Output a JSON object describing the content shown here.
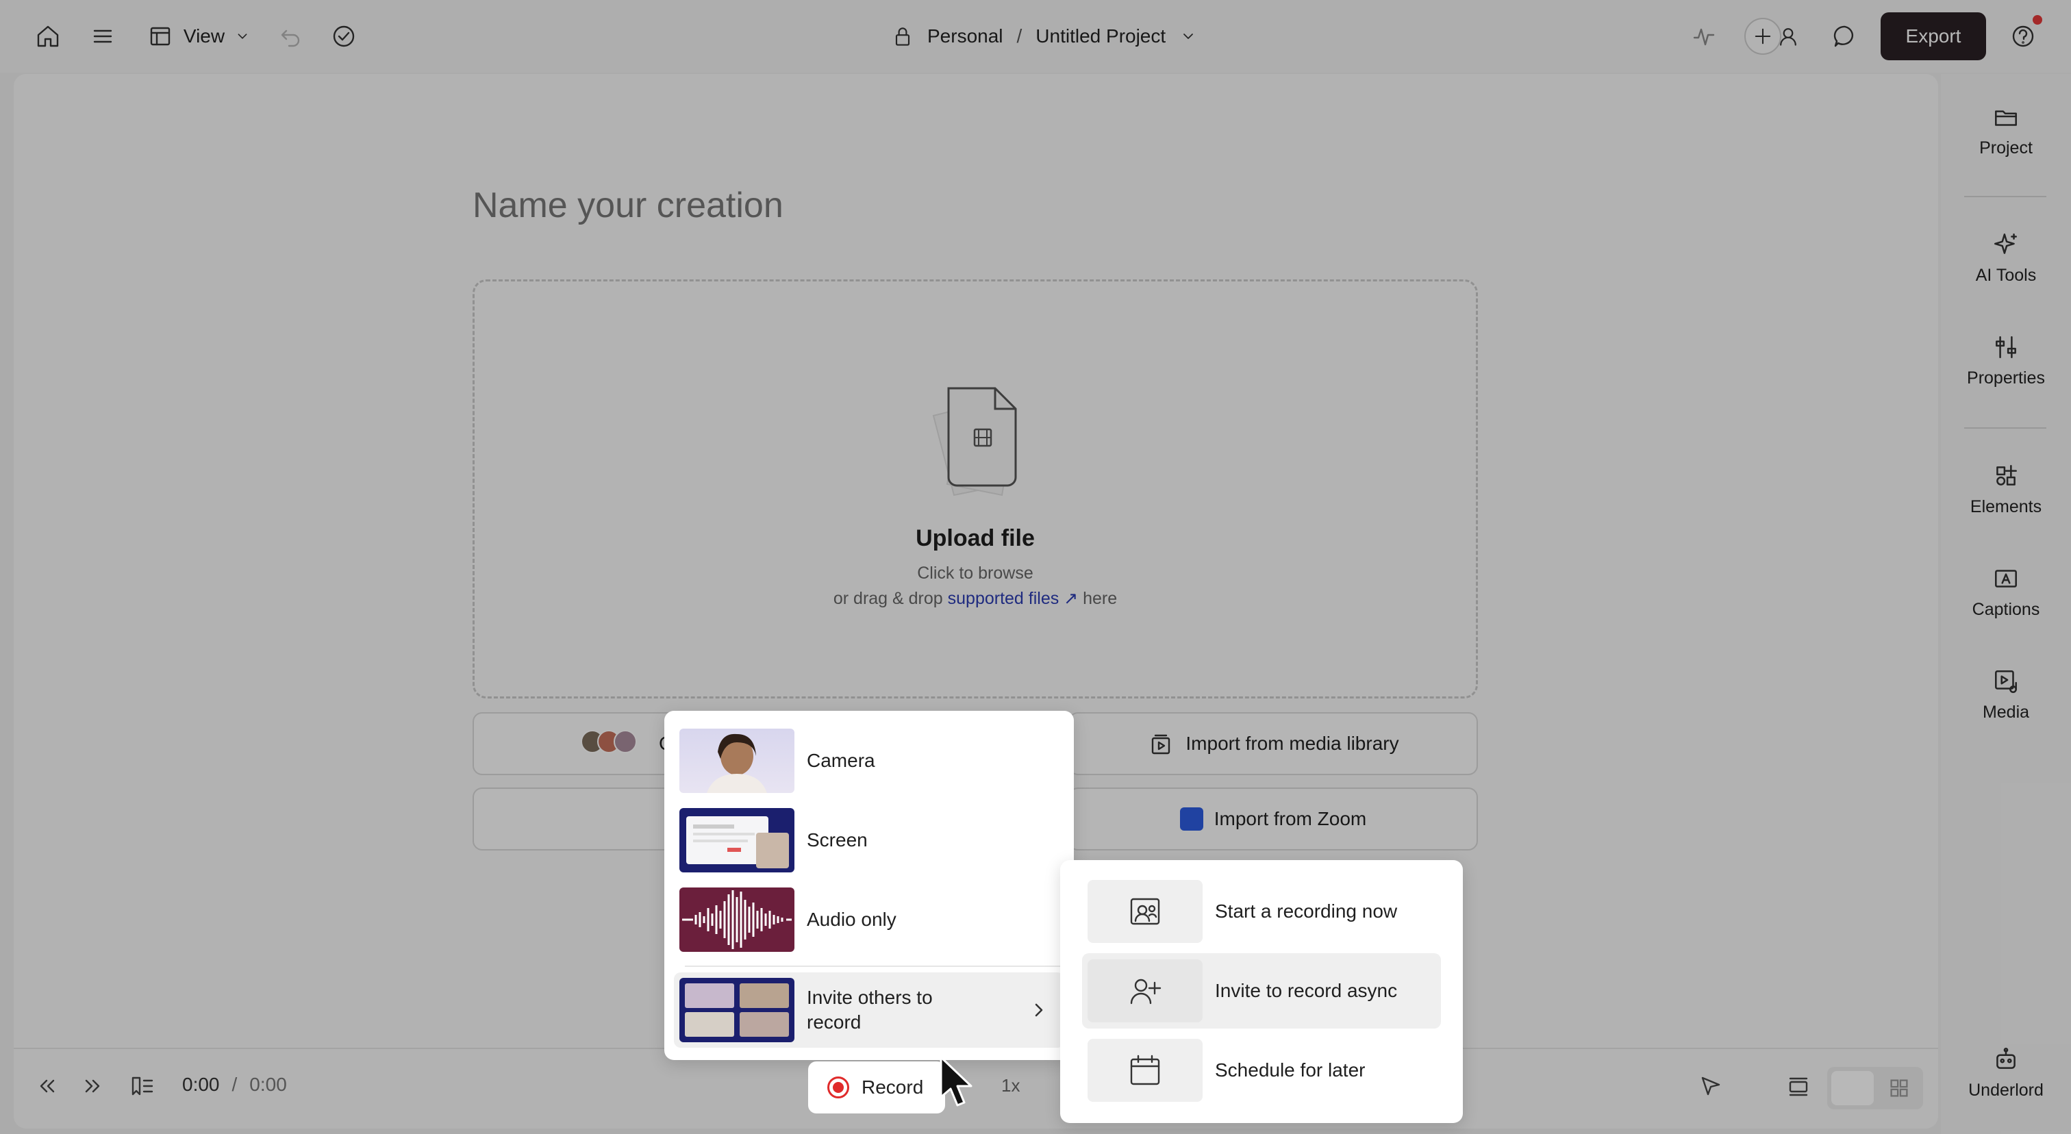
{
  "topbar": {
    "view_label": "View",
    "breadcrumb_workspace": "Personal",
    "breadcrumb_separator": "/",
    "breadcrumb_project": "Untitled Project",
    "export_label": "Export"
  },
  "canvas": {
    "name_placeholder": "Name your creation",
    "upload_title": "Upload file",
    "upload_line1": "Click to browse",
    "upload_line2_pre": "or drag & drop",
    "upload_link": "supported files ↗",
    "upload_line2_post": "here",
    "create_prefix": "Cr",
    "import_media_library": "Import from media library",
    "import_zoom": "Import from Zoom"
  },
  "bottombar": {
    "current_time": "0:00",
    "time_separator": "/",
    "duration": "0:00",
    "speed": "1x",
    "record_label": "Record"
  },
  "sidebar": {
    "items": [
      {
        "label": "Project",
        "icon": "folder-icon"
      },
      {
        "label": "AI Tools",
        "icon": "sparkle-icon"
      },
      {
        "label": "Properties",
        "icon": "sliders-icon"
      },
      {
        "label": "Elements",
        "icon": "shapes-icon"
      },
      {
        "label": "Captions",
        "icon": "captions-icon"
      },
      {
        "label": "Media",
        "icon": "media-icon"
      },
      {
        "label": "Underlord",
        "icon": "robot-icon"
      }
    ]
  },
  "record_menu": {
    "items": [
      {
        "label": "Camera"
      },
      {
        "label": "Screen"
      },
      {
        "label": "Audio only"
      },
      {
        "label_line1": "Invite others to",
        "label_line2": "record"
      }
    ]
  },
  "invite_submenu": {
    "items": [
      {
        "label": "Start a recording now"
      },
      {
        "label": "Invite to record async"
      },
      {
        "label": "Schedule for later"
      }
    ]
  },
  "colors": {
    "export_bg": "#2a2025",
    "record_red": "#e02b2b",
    "link_blue": "#2b3cb0",
    "zoom_blue": "#2d5ce0"
  }
}
